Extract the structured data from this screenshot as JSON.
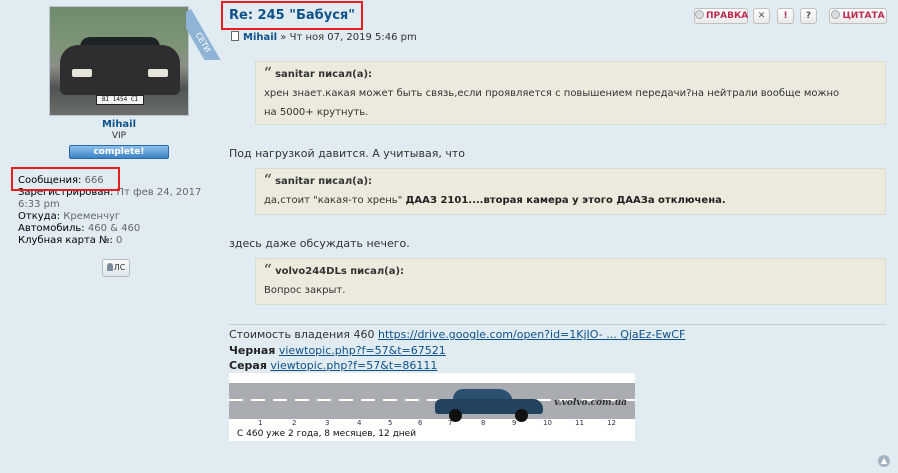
{
  "profile": {
    "avatar_plate": "BI 1454 CI",
    "ribbon": "СЕТИ",
    "username": "Mihail",
    "rank": "VIP",
    "rank_badge": "complete!",
    "stats": {
      "posts_label": "Сообщения:",
      "posts_value": "666",
      "registered_label": "Зарегистрирован:",
      "registered_value_1": "Пт фев 24, 2017",
      "registered_value_2": "6:33 pm",
      "from_label": "Откуда:",
      "from_value": "Кременчуг",
      "car_label": "Автомобиль:",
      "car_value": "460 & 460",
      "club_label": "Клубная карта №:",
      "club_value": "0"
    },
    "pm_button": "ЛС"
  },
  "post": {
    "title": "Re: 245 \"Бабуся\"",
    "author": "Mihail",
    "date": "» Чт ноя 07, 2019 5:46 pm",
    "buttons": {
      "edit": "ПРАВКА",
      "delete": "✕",
      "report": "!",
      "info": "?",
      "quote": "ЦИТАТА"
    },
    "quote1": {
      "cite": "sanitar писал(а):",
      "text_1": "хрен знает.какая может быть связь,если проявляется с повышением передачи?на нейтрали вообще можно",
      "text_2": "на 5000+ крутнуть."
    },
    "text1": "Под нагрузкой давится. А учитывая, что",
    "quote2": {
      "cite": "sanitar писал(а):",
      "text_plain": "да,стоит \"какая-то хрень\" ",
      "text_bold": "ДААЗ 2101....вторая камера у этого ДААЗа отключена."
    },
    "text2": "здесь даже обсуждать нечего.",
    "quote3": {
      "cite": "volvo244DLs писал(а):",
      "text": "Вопрос закрыт."
    }
  },
  "signature": {
    "line1_label": "Стоимость владения 460",
    "line1_link": "https://drive.google.com/open?id=1KjIO- ... QjaEz-EwCF",
    "line2_label": "Черная",
    "line2_link": "viewtopic.php?f=57&t=67521",
    "line3_label": "Серая",
    "line3_link": "viewtopic.php?f=57&t=86111",
    "banner_site": "v.volvo.com.ua",
    "banner_ticks": [
      "1",
      "2",
      "3",
      "4",
      "5",
      "6",
      "7",
      "8",
      "9",
      "10",
      "11",
      "12"
    ],
    "banner_caption": "С 460 уже 2 года, 8 месяцев, 12 дней"
  }
}
